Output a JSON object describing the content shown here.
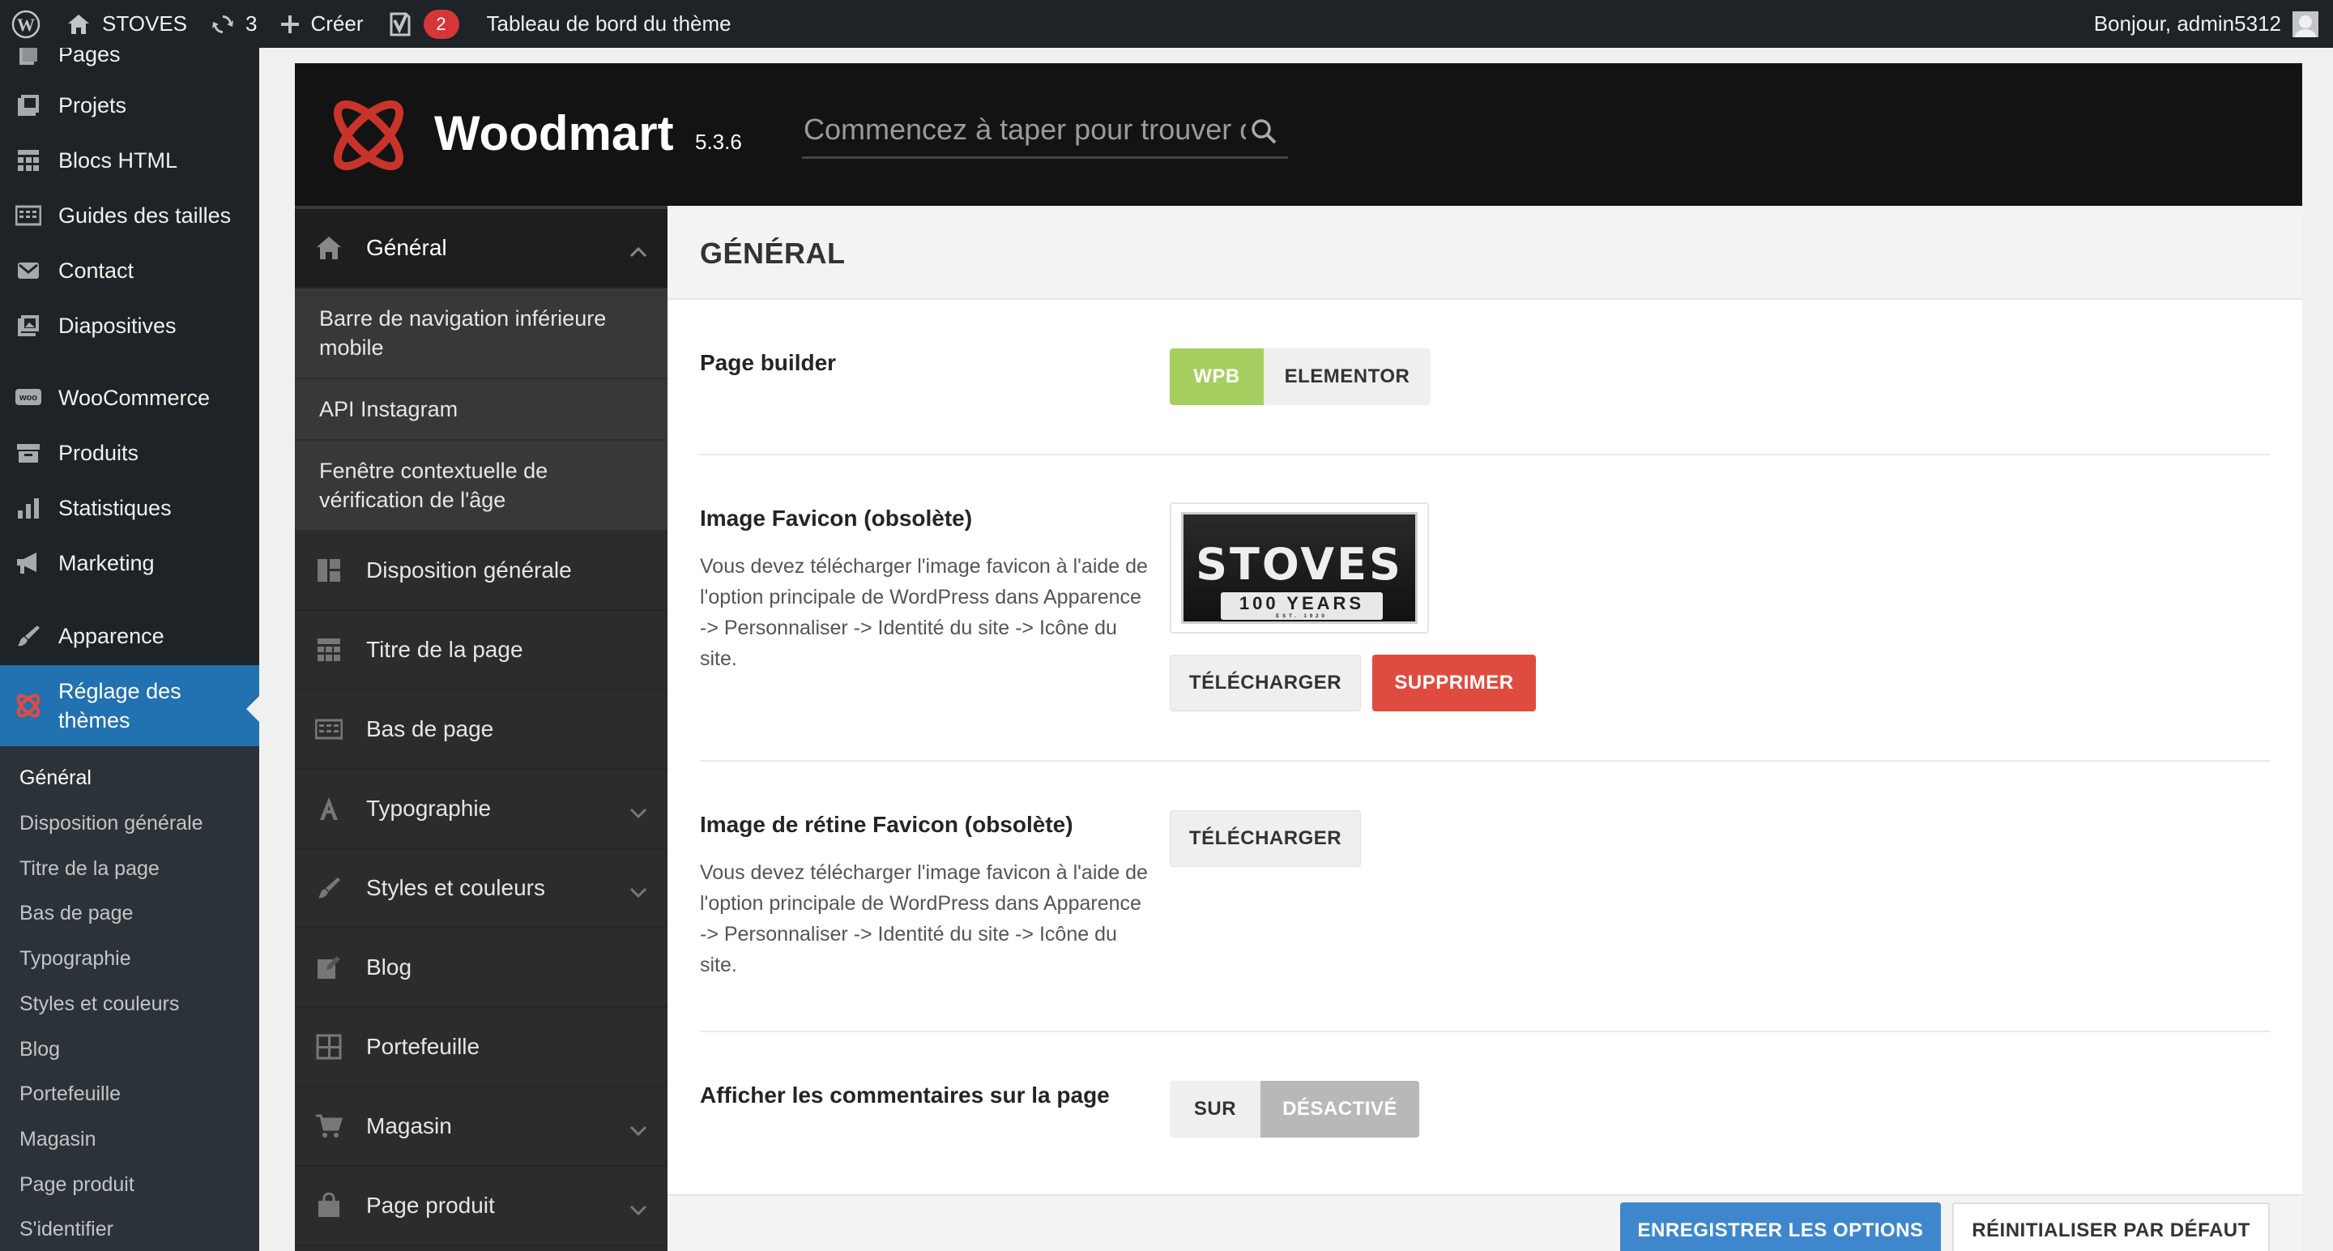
{
  "admin_bar": {
    "site_name": "STOVES",
    "updates_count": "3",
    "create_label": "Créer",
    "yoast_badge": "2",
    "theme_dashboard": "Tableau de bord du thème",
    "greeting": "Bonjour, admin5312"
  },
  "wp_menu": {
    "items": [
      {
        "label": "Pages",
        "icon": "pages-icon"
      },
      {
        "label": "Projets",
        "icon": "portfolio-icon"
      },
      {
        "label": "Blocs HTML",
        "icon": "blocks-icon"
      },
      {
        "label": "Guides des tailles",
        "icon": "table-icon"
      },
      {
        "label": "Contact",
        "icon": "mail-icon"
      },
      {
        "label": "Diapositives",
        "icon": "slides-icon"
      },
      {
        "label": "WooCommerce",
        "icon": "woocommerce-icon"
      },
      {
        "label": "Produits",
        "icon": "archive-icon"
      },
      {
        "label": "Statistiques",
        "icon": "chart-bar-icon"
      },
      {
        "label": "Marketing",
        "icon": "megaphone-icon"
      },
      {
        "label": "Apparence",
        "icon": "brush-icon"
      },
      {
        "label": "Réglage des thèmes",
        "icon": "woodmart-icon"
      }
    ],
    "submenu": [
      "Général",
      "Disposition générale",
      "Titre de la page",
      "Bas de page",
      "Typographie",
      "Styles et couleurs",
      "Blog",
      "Portefeuille",
      "Magasin",
      "Page produit",
      "S'identifier"
    ]
  },
  "woodmart": {
    "title": "Woodmart",
    "version": "5.3.6",
    "search_placeholder": "Commencez à taper pour trouver des options"
  },
  "nav": {
    "general": "Général",
    "sub": [
      "Barre de navigation inférieure mobile",
      "API Instagram",
      "Fenêtre contextuelle de vérification de l'âge"
    ],
    "items": [
      {
        "label": "Disposition générale",
        "icon": "layout-icon"
      },
      {
        "label": "Titre de la page",
        "icon": "page-title-icon"
      },
      {
        "label": "Bas de page",
        "icon": "footer-icon"
      },
      {
        "label": "Typographie",
        "icon": "typography-icon"
      },
      {
        "label": "Styles et couleurs",
        "icon": "brush-icon"
      },
      {
        "label": "Blog",
        "icon": "edit-icon"
      },
      {
        "label": "Portefeuille",
        "icon": "grid-icon"
      },
      {
        "label": "Magasin",
        "icon": "cart-icon"
      },
      {
        "label": "Page produit",
        "icon": "bag-icon"
      }
    ]
  },
  "content": {
    "section_title": "GÉNÉRAL",
    "page_builder": {
      "label": "Page builder",
      "options": [
        "WPB",
        "ELEMENTOR"
      ],
      "selected": "WPB"
    },
    "favicon": {
      "label": "Image Favicon (obsolète)",
      "description": "Vous devez télécharger l'image favicon à l'aide de l'option principale de WordPress dans Apparence -> Personnaliser -> Identité du site -> Icône du site.",
      "logo_text": "STOVES",
      "logo_band": "100 YEARS",
      "logo_small": "EST. 1920",
      "upload_label": "TÉLÉCHARGER",
      "remove_label": "SUPPRIMER"
    },
    "retina": {
      "label": "Image de rétine Favicon (obsolète)",
      "description": "Vous devez télécharger l'image favicon à l'aide de l'option principale de WordPress dans Apparence -> Personnaliser -> Identité du site -> Icône du site.",
      "upload_label": "TÉLÉCHARGER"
    },
    "comments": {
      "label": "Afficher les commentaires sur la page",
      "options": [
        "SUR",
        "DÉSACTIVÉ"
      ],
      "selected": "DÉSACTIVÉ"
    },
    "save_label": "ENREGISTRER LES OPTIONS",
    "reset_label": "RÉINITIALISER PAR DÉFAUT"
  },
  "colors": {
    "admin_bar": "#1d2327",
    "wp_active": "#2271b1",
    "wpb_green": "#a7cf5f",
    "remove_red": "#e04b3f",
    "save_blue": "#3f87cd"
  }
}
